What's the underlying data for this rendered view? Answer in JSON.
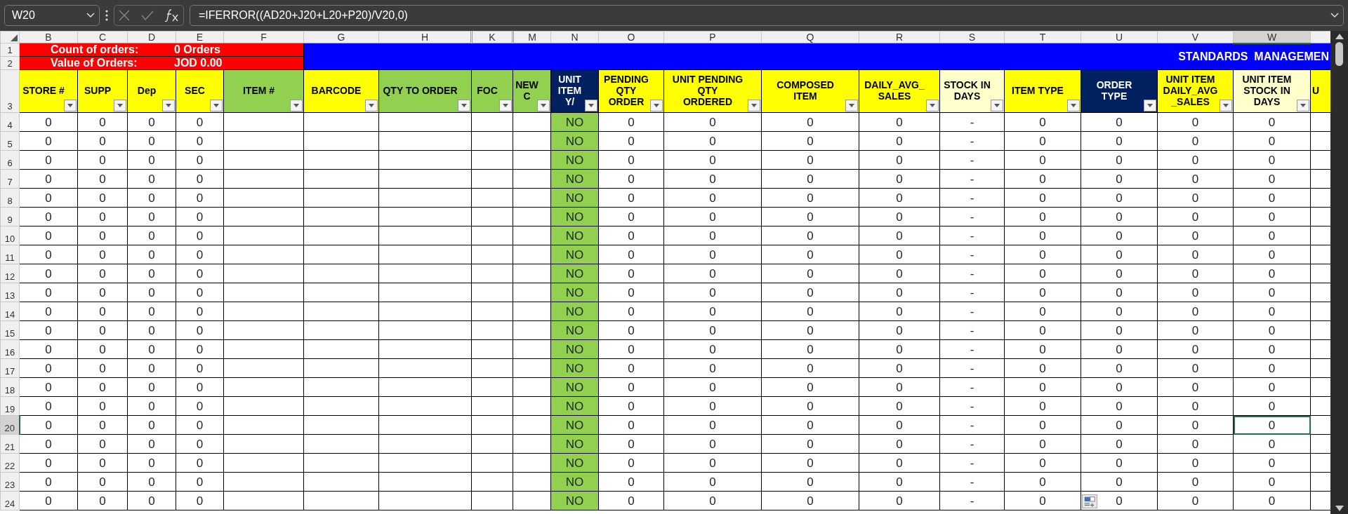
{
  "formula_bar": {
    "name_box": "W20",
    "formula": "=IFERROR((AD20+J20+L20+P20)/V20,0)"
  },
  "summary": [
    {
      "number": "1",
      "label": "Count of orders:",
      "value": "0 Orders"
    },
    {
      "number": "2",
      "label": "Value of Orders:",
      "value": "JOD 0.00"
    }
  ],
  "header_row_number": "3",
  "banner": "STANDARDS  MANAGEMEN",
  "columns": [
    {
      "letter": "B",
      "header": "STORE #",
      "color": "#ffff00",
      "filter": true,
      "selected": false
    },
    {
      "letter": "C",
      "header": "SUPP",
      "color": "#ffff00",
      "filter": true,
      "selected": false
    },
    {
      "letter": "D",
      "header": "Dep",
      "color": "#ffff00",
      "filter": true,
      "selected": false
    },
    {
      "letter": "E",
      "header": "SEC",
      "color": "#ffff00",
      "filter": true,
      "selected": false
    },
    {
      "letter": "F",
      "header": "ITEM #",
      "color": "#92d050",
      "filter": true,
      "selected": false
    },
    {
      "letter": "G",
      "header": "BARCODE",
      "color": "#ffff00",
      "filter": true,
      "selected": false
    },
    {
      "letter": "H",
      "header": "QTY TO ORDER",
      "color": "#92d050",
      "filter": true,
      "selected": false
    },
    {
      "letter": "K",
      "header": "FOC",
      "color": "#92d050",
      "filter": true,
      "selected": false,
      "hidden_before": true
    },
    {
      "letter": "M",
      "header": "NEW\nC",
      "color": "#92d050",
      "filter": true,
      "selected": false,
      "hidden_before": true
    },
    {
      "letter": "N",
      "header": "UNIT\nITEM\nY/",
      "color": "#002060",
      "filter": true,
      "selected": false,
      "cell_fill": {
        "color": "#92d050"
      }
    },
    {
      "letter": "O",
      "header": "PENDING\nQTY\nORDER",
      "color": "#ffff00",
      "filter": true,
      "selected": false
    },
    {
      "letter": "P",
      "header": "UNIT PENDING\nQTY\nORDERED",
      "color": "#ffff00",
      "filter": true,
      "selected": false
    },
    {
      "letter": "Q",
      "header": "COMPOSED\nITEM",
      "color": "#ffff00",
      "filter": true,
      "selected": false
    },
    {
      "letter": "R",
      "header": "DAILY_AVG_\nSALES",
      "color": "#ffff00",
      "filter": true,
      "selected": false
    },
    {
      "letter": "S",
      "header": "STOCK IN\nDAYS",
      "color": "#ffffcc",
      "filter": true,
      "selected": false
    },
    {
      "letter": "T",
      "header": "ITEM TYPE",
      "color": "#ffff00",
      "filter": true,
      "selected": false
    },
    {
      "letter": "U",
      "header": "ORDER\nTYPE",
      "color": "#002060",
      "filter": true,
      "selected": false
    },
    {
      "letter": "V",
      "header": "UNIT ITEM\nDAILY_AVG\n_SALES",
      "color": "#ffff00",
      "filter": true,
      "selected": false
    },
    {
      "letter": "W",
      "header": "UNIT ITEM\nSTOCK IN\nDAYS",
      "color": "#ffffcc",
      "filter": true,
      "selected": true
    },
    {
      "header": "U",
      "color": "#ffff00",
      "filter": false,
      "selected": false
    }
  ],
  "rows": [
    {
      "number": "4",
      "selected": false,
      "cells": {
        "B": "0",
        "C": "0",
        "D": "0",
        "E": "0",
        "N": "NO",
        "O": "0",
        "P": "0",
        "Q": "0",
        "R": "0",
        "S": "-",
        "T": "0",
        "U": "0",
        "V": "0",
        "W": "0"
      }
    },
    {
      "number": "5",
      "selected": false,
      "cells": {
        "B": "0",
        "C": "0",
        "D": "0",
        "E": "0",
        "N": "NO",
        "O": "0",
        "P": "0",
        "Q": "0",
        "R": "0",
        "S": "-",
        "T": "0",
        "U": "0",
        "V": "0",
        "W": "0"
      }
    },
    {
      "number": "6",
      "selected": false,
      "cells": {
        "B": "0",
        "C": "0",
        "D": "0",
        "E": "0",
        "N": "NO",
        "O": "0",
        "P": "0",
        "Q": "0",
        "R": "0",
        "S": "-",
        "T": "0",
        "U": "0",
        "V": "0",
        "W": "0"
      }
    },
    {
      "number": "7",
      "selected": false,
      "cells": {
        "B": "0",
        "C": "0",
        "D": "0",
        "E": "0",
        "N": "NO",
        "O": "0",
        "P": "0",
        "Q": "0",
        "R": "0",
        "S": "-",
        "T": "0",
        "U": "0",
        "V": "0",
        "W": "0"
      }
    },
    {
      "number": "8",
      "selected": false,
      "cells": {
        "B": "0",
        "C": "0",
        "D": "0",
        "E": "0",
        "N": "NO",
        "O": "0",
        "P": "0",
        "Q": "0",
        "R": "0",
        "S": "-",
        "T": "0",
        "U": "0",
        "V": "0",
        "W": "0"
      }
    },
    {
      "number": "9",
      "selected": false,
      "cells": {
        "B": "0",
        "C": "0",
        "D": "0",
        "E": "0",
        "N": "NO",
        "O": "0",
        "P": "0",
        "Q": "0",
        "R": "0",
        "S": "-",
        "T": "0",
        "U": "0",
        "V": "0",
        "W": "0"
      }
    },
    {
      "number": "10",
      "selected": false,
      "cells": {
        "B": "0",
        "C": "0",
        "D": "0",
        "E": "0",
        "N": "NO",
        "O": "0",
        "P": "0",
        "Q": "0",
        "R": "0",
        "S": "-",
        "T": "0",
        "U": "0",
        "V": "0",
        "W": "0"
      }
    },
    {
      "number": "11",
      "selected": false,
      "cells": {
        "B": "0",
        "C": "0",
        "D": "0",
        "E": "0",
        "N": "NO",
        "O": "0",
        "P": "0",
        "Q": "0",
        "R": "0",
        "S": "-",
        "T": "0",
        "U": "0",
        "V": "0",
        "W": "0"
      }
    },
    {
      "number": "12",
      "selected": false,
      "cells": {
        "B": "0",
        "C": "0",
        "D": "0",
        "E": "0",
        "N": "NO",
        "O": "0",
        "P": "0",
        "Q": "0",
        "R": "0",
        "S": "-",
        "T": "0",
        "U": "0",
        "V": "0",
        "W": "0"
      }
    },
    {
      "number": "13",
      "selected": false,
      "cells": {
        "B": "0",
        "C": "0",
        "D": "0",
        "E": "0",
        "N": "NO",
        "O": "0",
        "P": "0",
        "Q": "0",
        "R": "0",
        "S": "-",
        "T": "0",
        "U": "0",
        "V": "0",
        "W": "0"
      }
    },
    {
      "number": "14",
      "selected": false,
      "cells": {
        "B": "0",
        "C": "0",
        "D": "0",
        "E": "0",
        "N": "NO",
        "O": "0",
        "P": "0",
        "Q": "0",
        "R": "0",
        "S": "-",
        "T": "0",
        "U": "0",
        "V": "0",
        "W": "0"
      }
    },
    {
      "number": "15",
      "selected": false,
      "cells": {
        "B": "0",
        "C": "0",
        "D": "0",
        "E": "0",
        "N": "NO",
        "O": "0",
        "P": "0",
        "Q": "0",
        "R": "0",
        "S": "-",
        "T": "0",
        "U": "0",
        "V": "0",
        "W": "0"
      }
    },
    {
      "number": "16",
      "selected": false,
      "cells": {
        "B": "0",
        "C": "0",
        "D": "0",
        "E": "0",
        "N": "NO",
        "O": "0",
        "P": "0",
        "Q": "0",
        "R": "0",
        "S": "-",
        "T": "0",
        "U": "0",
        "V": "0",
        "W": "0"
      }
    },
    {
      "number": "17",
      "selected": false,
      "cells": {
        "B": "0",
        "C": "0",
        "D": "0",
        "E": "0",
        "N": "NO",
        "O": "0",
        "P": "0",
        "Q": "0",
        "R": "0",
        "S": "-",
        "T": "0",
        "U": "0",
        "V": "0",
        "W": "0"
      }
    },
    {
      "number": "18",
      "selected": false,
      "cells": {
        "B": "0",
        "C": "0",
        "D": "0",
        "E": "0",
        "N": "NO",
        "O": "0",
        "P": "0",
        "Q": "0",
        "R": "0",
        "S": "-",
        "T": "0",
        "U": "0",
        "V": "0",
        "W": "0"
      }
    },
    {
      "number": "19",
      "selected": false,
      "cells": {
        "B": "0",
        "C": "0",
        "D": "0",
        "E": "0",
        "N": "NO",
        "O": "0",
        "P": "0",
        "Q": "0",
        "R": "0",
        "S": "-",
        "T": "0",
        "U": "0",
        "V": "0",
        "W": "0"
      }
    },
    {
      "number": "20",
      "selected": true,
      "cells": {
        "B": "0",
        "C": "0",
        "D": "0",
        "E": "0",
        "N": "NO",
        "O": "0",
        "P": "0",
        "Q": "0",
        "R": "0",
        "S": "-",
        "T": "0",
        "U": "0",
        "V": "0",
        "W": "0"
      }
    },
    {
      "number": "21",
      "selected": false,
      "cells": {
        "B": "0",
        "C": "0",
        "D": "0",
        "E": "0",
        "N": "NO",
        "O": "0",
        "P": "0",
        "Q": "0",
        "R": "0",
        "S": "-",
        "T": "0",
        "U": "0",
        "V": "0",
        "W": "0"
      }
    },
    {
      "number": "22",
      "selected": false,
      "cells": {
        "B": "0",
        "C": "0",
        "D": "0",
        "E": "0",
        "N": "NO",
        "O": "0",
        "P": "0",
        "Q": "0",
        "R": "0",
        "S": "-",
        "T": "0",
        "U": "0",
        "V": "0",
        "W": "0"
      }
    },
    {
      "number": "23",
      "selected": false,
      "cells": {
        "B": "0",
        "C": "0",
        "D": "0",
        "E": "0",
        "N": "NO",
        "O": "0",
        "P": "0",
        "Q": "0",
        "R": "0",
        "S": "-",
        "T": "0",
        "U": "0",
        "V": "0",
        "W": "0"
      }
    },
    {
      "number": "24",
      "selected": false,
      "cells": {
        "B": "0",
        "C": "0",
        "D": "0",
        "E": "0",
        "N": "NO",
        "O": "0",
        "P": "0",
        "Q": "0",
        "R": "0",
        "S": "-",
        "T": "0",
        "U": "0",
        "V": "0",
        "W": "0"
      }
    }
  ]
}
